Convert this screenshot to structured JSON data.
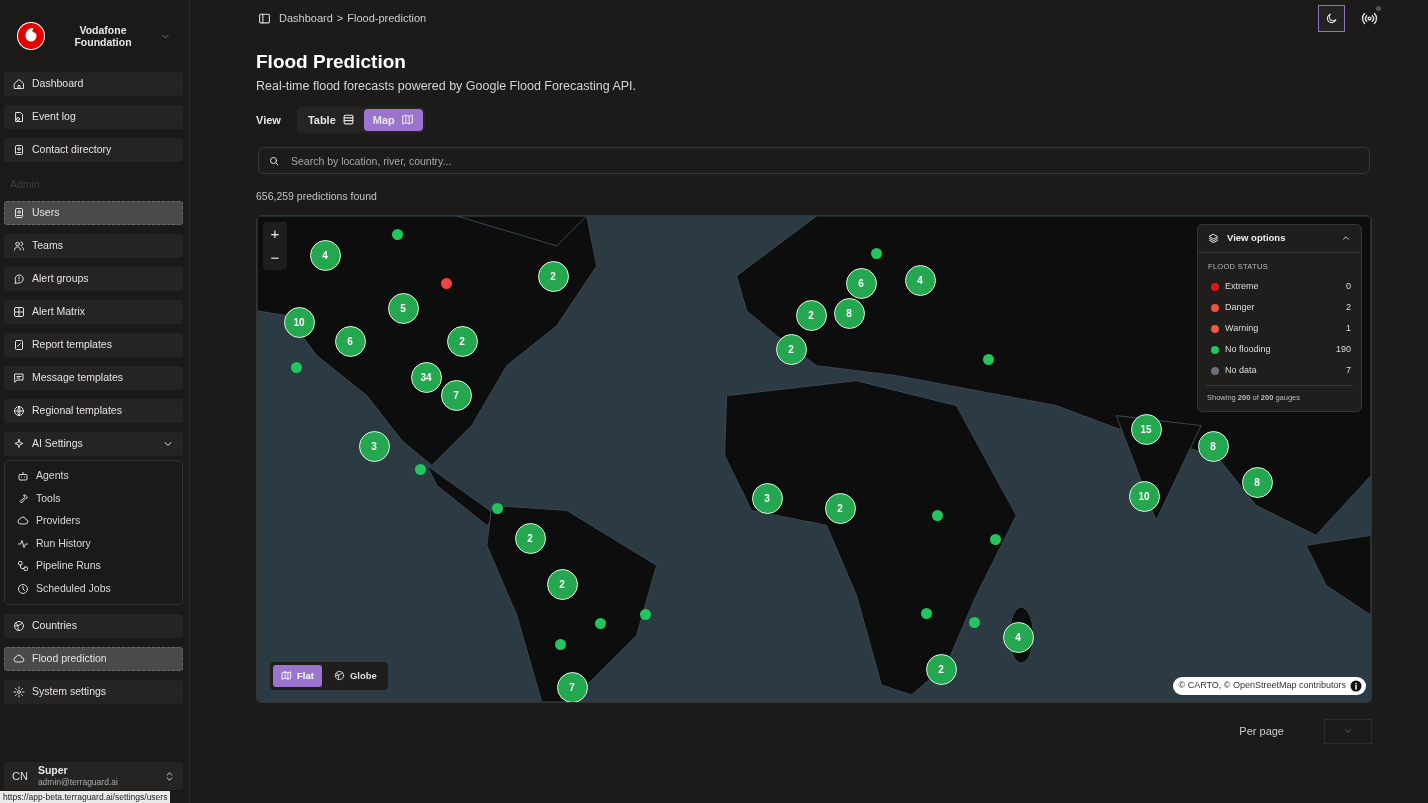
{
  "sidebar": {
    "brand": "Vodafone Foundation",
    "items": [
      {
        "label": "Dashboard",
        "selected": false
      },
      {
        "label": "Event log",
        "selected": false
      },
      {
        "label": "Contact directory",
        "selected": false
      }
    ],
    "section_label": "Admin",
    "admin_items": [
      {
        "label": "Users",
        "selected": true
      },
      {
        "label": "Teams",
        "selected": false
      },
      {
        "label": "Alert groups",
        "selected": false
      },
      {
        "label": "Alert Matrix",
        "selected": false
      },
      {
        "label": "Report templates",
        "selected": false
      },
      {
        "label": "Message templates",
        "selected": false
      },
      {
        "label": "Regional templates",
        "selected": false
      },
      {
        "label": "AI Settings",
        "selected": false,
        "expanded": true,
        "children": [
          {
            "label": "Agents"
          },
          {
            "label": "Tools"
          },
          {
            "label": "Providers"
          },
          {
            "label": "Run History"
          },
          {
            "label": "Pipeline Runs"
          },
          {
            "label": "Scheduled Jobs"
          }
        ]
      },
      {
        "label": "Countries",
        "selected": false
      },
      {
        "label": "Flood prediction",
        "selected": true
      },
      {
        "label": "System settings",
        "selected": false
      }
    ],
    "user": {
      "initials": "CN",
      "name": "Super",
      "email": "admin@terraguard.ai"
    }
  },
  "status_url": "https://app-beta.terraguard.ai/settings/users",
  "breadcrumb": {
    "items": [
      "Dashboard",
      "Flood-prediction"
    ],
    "separator": ">"
  },
  "title": "Flood Prediction",
  "subtitle": "Real-time flood forecasts powered by Google Flood Forecasting API.",
  "view": {
    "label": "View",
    "options": [
      {
        "label": "Table",
        "selected": false
      },
      {
        "label": "Map",
        "selected": true
      }
    ]
  },
  "search": {
    "placeholder": "Search by location, river, country..."
  },
  "result_count": "656,259 predictions found",
  "map": {
    "clusters": [
      {
        "count": "4"
      },
      {
        "count": "2"
      },
      {
        "count": "5"
      },
      {
        "count": "10"
      },
      {
        "count": "6"
      },
      {
        "count": "2"
      },
      {
        "count": "34"
      },
      {
        "count": "7"
      },
      {
        "count": "3"
      },
      {
        "count": "2"
      },
      {
        "count": "2"
      },
      {
        "count": "7"
      },
      {
        "count": "6"
      },
      {
        "count": "4"
      },
      {
        "count": "2"
      },
      {
        "count": "8"
      },
      {
        "count": "2"
      },
      {
        "count": "15"
      },
      {
        "count": "8"
      },
      {
        "count": "10"
      },
      {
        "count": "8"
      },
      {
        "count": "3"
      },
      {
        "count": "2"
      },
      {
        "count": "4"
      },
      {
        "count": "2"
      }
    ],
    "dots": [
      {
        "color": "#22c55e"
      },
      {
        "color": "#ef4444"
      },
      {
        "color": "#22c55e"
      },
      {
        "color": "#22c55e"
      },
      {
        "color": "#22c55e"
      },
      {
        "color": "#22c55e"
      },
      {
        "color": "#22c55e"
      },
      {
        "color": "#22c55e"
      },
      {
        "color": "#22c55e"
      },
      {
        "color": "#22c55e"
      },
      {
        "color": "#22c55e"
      },
      {
        "color": "#22c55e"
      },
      {
        "color": "#22c55e"
      },
      {
        "color": "#22c55e"
      }
    ],
    "zoom_in": "+",
    "zoom_out": "−",
    "view_options": {
      "title": "View options",
      "expanded": true,
      "section": "FLOOD STATUS",
      "legend": [
        {
          "label": "Extreme",
          "count": "0",
          "color": "#e0161b"
        },
        {
          "label": "Danger",
          "count": "2",
          "color": "#f0503e"
        },
        {
          "label": "Warning",
          "count": "1",
          "color": "#ee5a3f"
        },
        {
          "label": "No flooding",
          "count": "190",
          "color": "#22c55e"
        },
        {
          "label": "No data",
          "count": "7",
          "color": "#6b6e75"
        }
      ],
      "footer": "Showing **200** of **200** gauges"
    },
    "modes": [
      {
        "label": "Flat",
        "selected": true
      },
      {
        "label": "Globe",
        "selected": false
      }
    ],
    "attribution": "© CARTO, © OpenStreetMap contributors"
  },
  "per_page": {
    "label": "Per page"
  }
}
